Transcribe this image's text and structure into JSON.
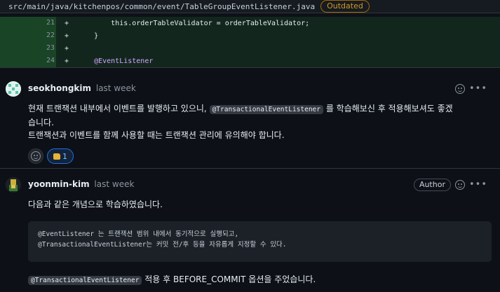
{
  "file": {
    "path": "src/main/java/kitchenpos/common/event/TableGroupEventListener.java",
    "status_badge": "Outdated"
  },
  "diff": {
    "lines": [
      {
        "num": "21",
        "sign": "+",
        "code": "        this.orderTableValidator = orderTableValidator;"
      },
      {
        "num": "22",
        "sign": "+",
        "code": "    }"
      },
      {
        "num": "23",
        "sign": "+",
        "code": ""
      },
      {
        "num": "24",
        "sign": "+",
        "code": "    @EventListener"
      }
    ]
  },
  "comments": [
    {
      "author": "seokhongkim",
      "time": "last week",
      "body_line1_pre": "현재 트랜잭션 내부에서 이벤트를 발행하고 있으니,",
      "body_line1_code": "@TransactionalEventListener",
      "body_line1_post": "를 학습해보신 후 적용해보셔도 좋겠",
      "body_line2": "습니다.",
      "body_line3": "트랜잭션과 이벤트를 함께 사용할 때는 트랜잭션 관리에 유의해야 합니다.",
      "reaction_emoji": "thumbs-up",
      "reaction_count": "1"
    },
    {
      "author": "yoonmin-kim",
      "time": "last week",
      "badge": "Author",
      "body_line1": "다음과 같은 개념으로 학습하였습니다.",
      "code_line1": "@EventListener 는 트랜잭션 범위 내에서 동기적으로 실행되고,",
      "code_line2": "@TransactionalEventListener는 커밋 전/후 등을 자유롭게 지정할 수 있다.",
      "body_last_code": "@TransactionalEventListener",
      "body_last_post": "적용 후 BEFORE_COMMIT 옵션을 주었습니다."
    }
  ],
  "colors": {
    "background": "#0d1117",
    "added_line": "#1a3a27",
    "outdated": "#d29922",
    "annotation": "#d2a8ff",
    "reaction_accent": "#1f6feb"
  }
}
